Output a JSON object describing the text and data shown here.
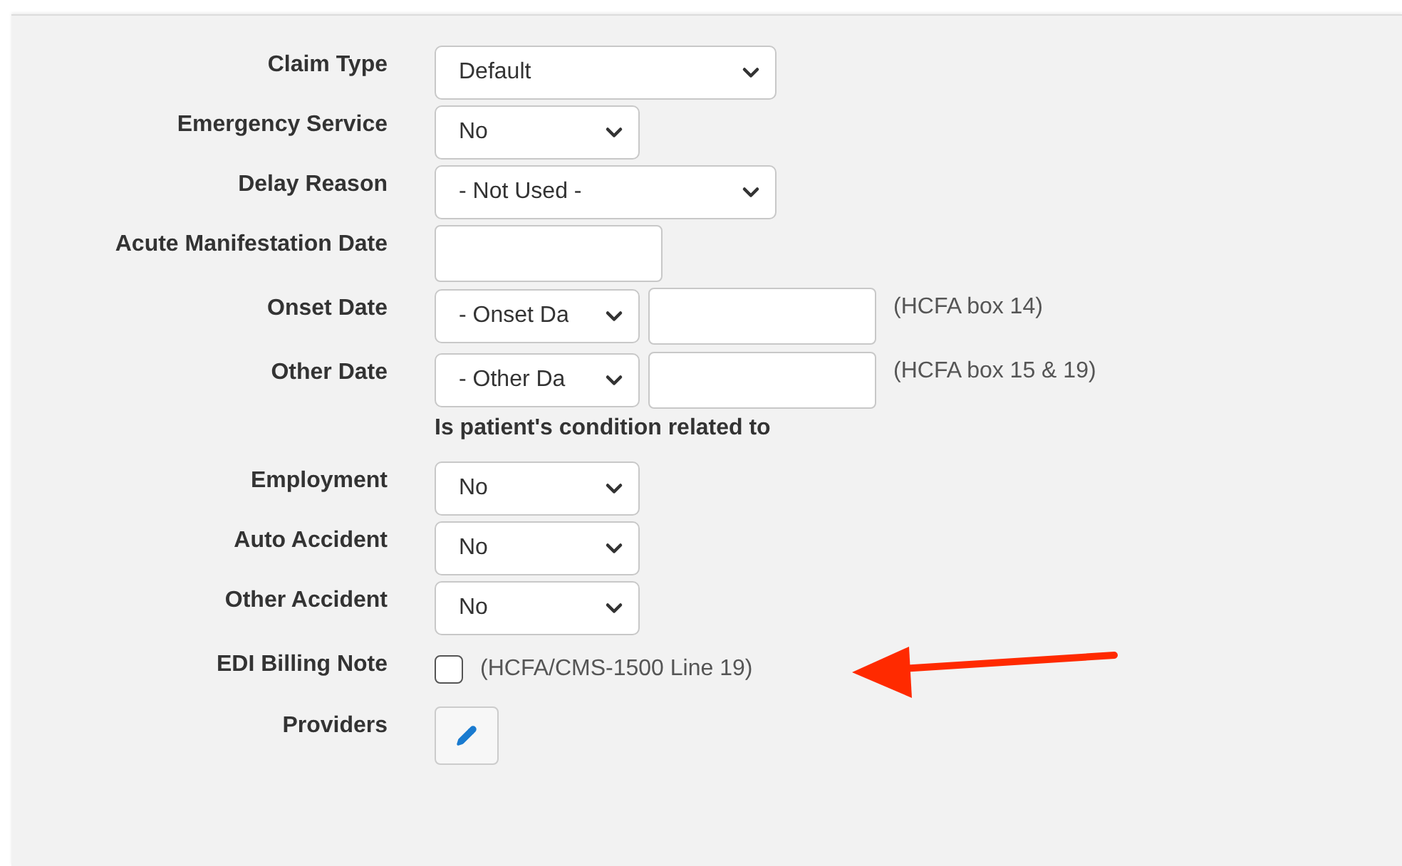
{
  "form": {
    "rows": [
      {
        "kind": "wide_select",
        "label": "Claim Type",
        "value": "Default"
      },
      {
        "kind": "select",
        "label": "Emergency Service",
        "value": "No"
      },
      {
        "kind": "wide_select",
        "label": "Delay Reason",
        "value": "- Not Used -"
      },
      {
        "kind": "text",
        "label": "Acute Manifestation Date"
      },
      {
        "kind": "date_pair",
        "label": "Onset Date",
        "value": "- Onset Da",
        "note": "(HCFA box 14)"
      },
      {
        "kind": "date_pair",
        "label": "Other Date",
        "value": "- Other Da",
        "note": "(HCFA box 15 & 19)"
      },
      {
        "kind": "heading",
        "text": "Is patient's condition related to"
      },
      {
        "kind": "select",
        "label": "Employment",
        "value": "No"
      },
      {
        "kind": "select",
        "label": "Auto Accident",
        "value": "No"
      },
      {
        "kind": "select",
        "label": "Other Accident",
        "value": "No"
      },
      {
        "kind": "checkbox",
        "label": "EDI Billing Note",
        "checked": false,
        "note": "(HCFA/CMS-1500 Line 19)",
        "annotated": true
      },
      {
        "kind": "edit_button",
        "label": "Providers"
      }
    ]
  }
}
